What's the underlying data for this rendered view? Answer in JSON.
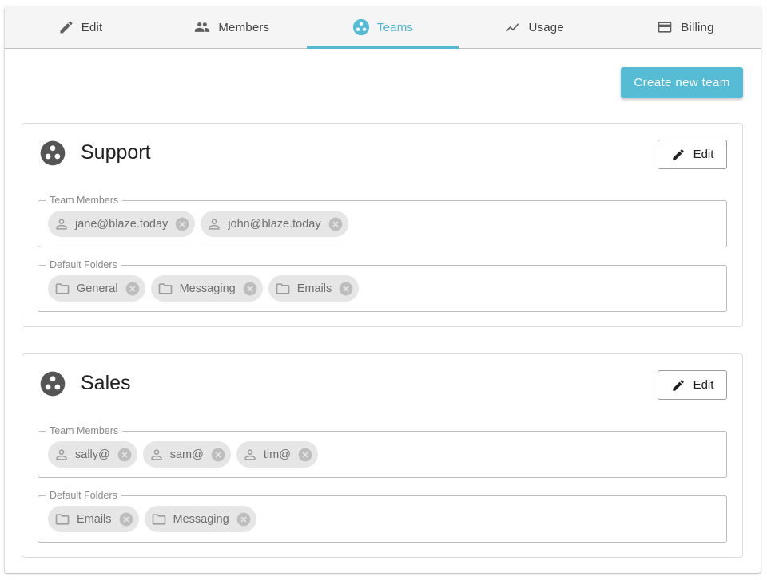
{
  "tabs": [
    {
      "label": "Edit",
      "icon": "pencil-icon",
      "active": false
    },
    {
      "label": "Members",
      "icon": "people-icon",
      "active": false
    },
    {
      "label": "Teams",
      "icon": "team-icon",
      "active": true
    },
    {
      "label": "Usage",
      "icon": "trend-icon",
      "active": false
    },
    {
      "label": "Billing",
      "icon": "credit-card-icon",
      "active": false
    }
  ],
  "create_button_label": "Create new team",
  "edit_label": "Edit",
  "team_members_legend": "Team Members",
  "default_folders_legend": "Default Folders",
  "teams": [
    {
      "name": "Support",
      "members": [
        "jane@blaze.today",
        "john@blaze.today"
      ],
      "folders": [
        "General",
        "Messaging",
        "Emails"
      ]
    },
    {
      "name": "Sales",
      "members": [
        "sally@",
        "sam@",
        "tim@"
      ],
      "folders": [
        "Emails",
        "Messaging"
      ]
    }
  ],
  "colors": {
    "accent": "#56bcd5",
    "chip_bg": "#e6e6e6",
    "tab_bar_bg": "#f5f5f5"
  }
}
